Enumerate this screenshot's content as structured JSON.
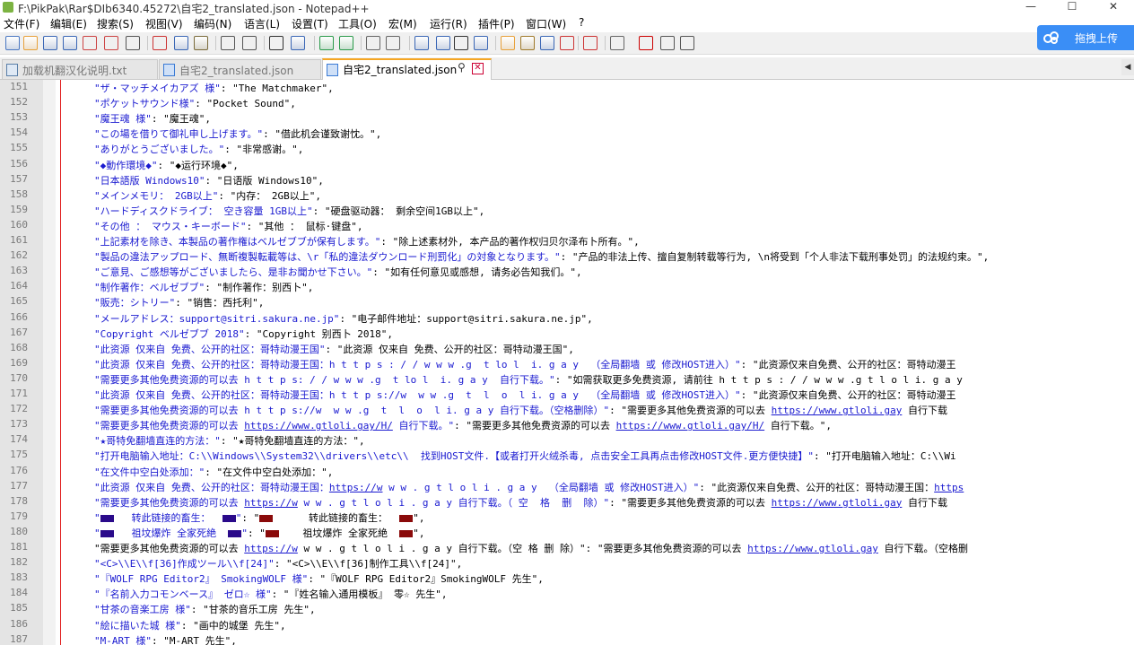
{
  "window": {
    "title": "F:\\PikPak\\Rar$DIb6340.45272\\自宅2_translated.json - Notepad++",
    "minimize": "—",
    "maximize": "☐",
    "close": "✕"
  },
  "menu": [
    "文件(F)",
    "编辑(E)",
    "搜索(S)",
    "视图(V)",
    "编码(N)",
    "语言(L)",
    "设置(T)",
    "工具(O)",
    "宏(M)",
    "运行(R)",
    "插件(P)",
    "窗口(W)",
    "?"
  ],
  "upload": {
    "label": "拖拽上传"
  },
  "tabs": [
    {
      "label": "加载机翻汉化说明.txt",
      "active": false
    },
    {
      "label": "自宅2_translated.json",
      "active": false
    },
    {
      "label": "自宅2_translated.json",
      "active": true
    }
  ],
  "tab_controls": {
    "pin": "⚲",
    "close": "✕",
    "scroll": "◀"
  },
  "toolbar_icons": [
    "new-icon",
    "open-icon",
    "save-icon",
    "save-all-icon",
    "close-icon",
    "close-all-icon",
    "print-icon",
    "cut-icon",
    "copy-icon",
    "paste-icon",
    "undo-icon",
    "redo-icon",
    "find-icon",
    "replace-icon",
    "zoom-in-icon",
    "zoom-out-icon",
    "sync-v-icon",
    "sync-h-icon",
    "wrap-icon",
    "all-chars-icon",
    "indent-guide-icon",
    "udl-icon",
    "doc-map-icon",
    "func-list-icon",
    "folder-workspace-icon",
    "monitor-icon",
    "record-icon",
    "stop-icon",
    "play-icon",
    "play-multi-icon",
    "save-macro-icon"
  ],
  "lines": [
    {
      "n": "151",
      "seg": [
        [
          "k",
          "\"ザ・マッチメイカアズ 様\""
        ],
        [
          "v",
          ": \"The Matchmaker\","
        ]
      ]
    },
    {
      "n": "152",
      "seg": [
        [
          "k",
          "\"ポケットサウンド様\""
        ],
        [
          "v",
          ": \"Pocket Sound\","
        ]
      ]
    },
    {
      "n": "153",
      "seg": [
        [
          "k",
          "\"魔王魂 様\""
        ],
        [
          "v",
          ": \"魔王魂\","
        ]
      ]
    },
    {
      "n": "154",
      "seg": [
        [
          "k",
          "\"この場を借りて御礼申し上げます。\""
        ],
        [
          "v",
          ": \"借此机会谨致谢忱。\","
        ]
      ]
    },
    {
      "n": "155",
      "seg": [
        [
          "k",
          "\"ありがとうございました。\""
        ],
        [
          "v",
          ": \"非常感谢。\","
        ]
      ]
    },
    {
      "n": "156",
      "seg": [
        [
          "k",
          "\"◆動作環境◆\""
        ],
        [
          "v",
          ": \"◆运行环境◆\","
        ]
      ]
    },
    {
      "n": "157",
      "seg": [
        [
          "k",
          "\"日本語版 Windows10\""
        ],
        [
          "v",
          ": \"日语版 Windows10\","
        ]
      ]
    },
    {
      "n": "158",
      "seg": [
        [
          "k",
          "\"メインメモリ： 2GB以上\""
        ],
        [
          "v",
          ": \"内存： 2GB以上\","
        ]
      ]
    },
    {
      "n": "159",
      "seg": [
        [
          "k",
          "\"ハードディスクドライブ： 空き容量 1GB以上\""
        ],
        [
          "v",
          ": \"硬盘驱动器： 剩余空间1GB以上\","
        ]
      ]
    },
    {
      "n": "160",
      "seg": [
        [
          "k",
          "\"その他 ： マウス・キーボード\""
        ],
        [
          "v",
          ": \"其他 ： 鼠标·键盘\","
        ]
      ]
    },
    {
      "n": "161",
      "seg": [
        [
          "k",
          "\"上記素材を除き、本製品の著作権はベルゼブブが保有します。\""
        ],
        [
          "v",
          ": \"除上述素材外, 本产品的著作权归贝尔泽布卜所有。\","
        ]
      ]
    },
    {
      "n": "162",
      "seg": [
        [
          "k",
          "\"製品の違法アップロード、無断複製転載等は、\\r「私的違法ダウンロード刑罰化」の対象となります。\""
        ],
        [
          "v",
          ": \"产品的非法上传、擅自复制转载等行为, \\n将受到「个人非法下载刑事处罚」的法规约束。\","
        ]
      ]
    },
    {
      "n": "163",
      "seg": [
        [
          "k",
          "\"ご意見、ご感想等がございましたら、是非お聞かせ下さい。\""
        ],
        [
          "v",
          ": \"如有任何意见或感想, 请务必告知我们。\","
        ]
      ]
    },
    {
      "n": "164",
      "seg": [
        [
          "k",
          "\"制作著作：ベルゼブブ\""
        ],
        [
          "v",
          ": \"制作著作：别西卜\","
        ]
      ]
    },
    {
      "n": "165",
      "seg": [
        [
          "k",
          "\"販売：シトリー\""
        ],
        [
          "v",
          ": \"销售：西托利\","
        ]
      ]
    },
    {
      "n": "166",
      "seg": [
        [
          "k",
          "\"メールアドレス：support@sitri.sakura.ne.jp\""
        ],
        [
          "v",
          ": \"电子邮件地址：support@sitri.sakura.ne.jp\","
        ]
      ]
    },
    {
      "n": "167",
      "seg": [
        [
          "k",
          "\"Copyright ベルゼブブ 2018\""
        ],
        [
          "v",
          ": \"Copyright 别西卜 2018\","
        ]
      ]
    },
    {
      "n": "168",
      "seg": [
        [
          "k",
          "\"此资源 仅来自 免费、公开的社区：哥特动漫王国\""
        ],
        [
          "v",
          ": \"此资源 仅来自 免费、公开的社区：哥特动漫王国\","
        ]
      ]
    },
    {
      "n": "169",
      "seg": [
        [
          "k",
          "\"此资源 仅来自 免费、公开的社区：哥特动漫王国：h t t p s : / / w w w .g  t lo l  i. g a y  （全局翻墙 或 修改HOST进入）\""
        ],
        [
          "v",
          ": \"此资源仅来自免费、公开的社区：哥特动漫王"
        ]
      ]
    },
    {
      "n": "170",
      "seg": [
        [
          "k",
          "\"需要更多其他免费资源的可以去 h t t p s: / / w w w .g  t lo l  i. g a y  自行下载。\""
        ],
        [
          "v",
          ": \"如需获取更多免费资源, 请前往 h t t p s : / / w w w .g t l o l i. g a y"
        ]
      ]
    },
    {
      "n": "171",
      "seg": [
        [
          "k",
          "\"此资源 仅来自 免费、公开的社区：哥特动漫王国：h t t p s://w  w w .g  t  l  o  l i. g a y  （全局翻墙 或 修改HOST进入）\""
        ],
        [
          "v",
          ": \"此资源仅来自免费、公开的社区：哥特动漫王"
        ]
      ]
    },
    {
      "n": "172",
      "seg": [
        [
          "k",
          "\"需要更多其他免费资源的可以去 h t t p s://w  w w .g  t  l  o  l i. g a y 自行下载。（空格删除）\""
        ],
        [
          "v",
          ": \"需要更多其他免费资源的可以去 "
        ],
        [
          "lnk",
          "https://www.gtloli.gay"
        ],
        [
          "v",
          " 自行下载"
        ]
      ]
    },
    {
      "n": "173",
      "seg": [
        [
          "k",
          "\"需要更多其他免费资源的可以去 "
        ],
        [
          "lnk",
          "https://www.gtloli.gay/H/"
        ],
        [
          "k",
          " 自行下载。\""
        ],
        [
          "v",
          ": \"需要更多其他免费资源的可以去 "
        ],
        [
          "lnk",
          "https://www.gtloli.gay/H/"
        ],
        [
          "v",
          " 自行下载。\","
        ]
      ]
    },
    {
      "n": "174",
      "seg": [
        [
          "k",
          "\"★哥特免翻墙直连的方法：\""
        ],
        [
          "v",
          ": \"★哥特免翻墙直连的方法：\","
        ]
      ]
    },
    {
      "n": "175",
      "seg": [
        [
          "k",
          "\"打开电脑输入地址：C:\\\\Windows\\\\System32\\\\drivers\\\\etc\\\\  找到HOST文件.【或者打开火绒杀毒, 点击安全工具再点击修改HOST文件.更方便快捷】\""
        ],
        [
          "v",
          ": \"打开电脑输入地址：C:\\\\Wi"
        ]
      ]
    },
    {
      "n": "176",
      "seg": [
        [
          "k",
          "\"在文件中空白处添加：\""
        ],
        [
          "v",
          ": \"在文件中空白处添加：\","
        ]
      ]
    },
    {
      "n": "177",
      "seg": [
        [
          "k",
          "\"此资源 仅来自 免费、公开的社区：哥特动漫王国："
        ],
        [
          "lnk",
          "https://w"
        ],
        [
          "k",
          " w w . g t l o l i . g a y  （全局翻墙 或 修改HOST进入）\""
        ],
        [
          "v",
          ": \"此资源仅来自免费、公开的社区：哥特动漫王国："
        ],
        [
          "lnk",
          "https"
        ]
      ]
    },
    {
      "n": "178",
      "seg": [
        [
          "k",
          "\"需要更多其他免费资源的可以去 "
        ],
        [
          "lnk",
          "https://w"
        ],
        [
          "k",
          " w w . g t l o l i . g a y 自行下载。（ 空  格  删  除）\""
        ],
        [
          "v",
          ": \"需要更多其他免费资源的可以去 "
        ],
        [
          "lnk",
          "https://www.gtloli.gay"
        ],
        [
          "v",
          " 自行下载"
        ]
      ]
    },
    {
      "n": "179",
      "seg": [
        [
          "k",
          "\""
        ],
        [
          "blk",
          ""
        ],
        [
          "k",
          "   转此链接的畜生：  "
        ],
        [
          "blk",
          ""
        ],
        [
          "k",
          "\""
        ],
        [
          "v",
          ": \""
        ],
        [
          "blkr",
          ""
        ],
        [
          "v",
          "      转此链接的畜生：  "
        ],
        [
          "blkr",
          ""
        ],
        [
          "v",
          "\","
        ]
      ]
    },
    {
      "n": "180",
      "seg": [
        [
          "k",
          "\""
        ],
        [
          "blk",
          ""
        ],
        [
          "k",
          "   祖坟爆炸 全家死絶  "
        ],
        [
          "blk",
          ""
        ],
        [
          "k",
          "\""
        ],
        [
          "v",
          ": \""
        ],
        [
          "blkr",
          ""
        ],
        [
          "v",
          "    祖坟爆炸 全家死絶  "
        ],
        [
          "blkr",
          ""
        ],
        [
          "v",
          "\","
        ]
      ]
    },
    {
      "n": "181",
      "seg": [
        [
          "v",
          "\"需要更多其他免费资源的可以去 "
        ],
        [
          "lnk",
          "https://w"
        ],
        [
          "v",
          " w w . g t l o l i . g a y 自行下载。（空 格 删 除）\": \"需要更多其他免费资源的可以去 "
        ],
        [
          "lnk",
          "https://www.gtloli.gay"
        ],
        [
          "v",
          " 自行下载。（空格删"
        ]
      ]
    },
    {
      "n": "182",
      "seg": [
        [
          "k",
          "\"<C>\\\\E\\\\f[36]作成ツール\\\\f[24]\""
        ],
        [
          "v",
          ": \"<C>\\\\E\\\\f[36]制作工具\\\\f[24]\","
        ]
      ]
    },
    {
      "n": "183",
      "seg": [
        [
          "k",
          "\"『WOLF RPG Editor2』 SmokingWOLF 様\""
        ],
        [
          "v",
          ": \"『WOLF RPG Editor2』SmokingWOLF 先生\","
        ]
      ]
    },
    {
      "n": "184",
      "seg": [
        [
          "k",
          "\"『名前入力コモンベース』 ゼロ☆ 様\""
        ],
        [
          "v",
          ": \"『姓名输入通用模板』 零☆ 先生\","
        ]
      ]
    },
    {
      "n": "185",
      "seg": [
        [
          "k",
          "\"甘茶の音楽工房 様\""
        ],
        [
          "v",
          ": \"甘茶的音乐工房 先生\","
        ]
      ]
    },
    {
      "n": "186",
      "seg": [
        [
          "k",
          "\"絵に描いた城 様\""
        ],
        [
          "v",
          ": \"画中的城堡 先生\","
        ]
      ]
    },
    {
      "n": "187",
      "seg": [
        [
          "k",
          "\"M-ART 様\""
        ],
        [
          "v",
          ": \"M-ART 先生\","
        ]
      ]
    }
  ]
}
